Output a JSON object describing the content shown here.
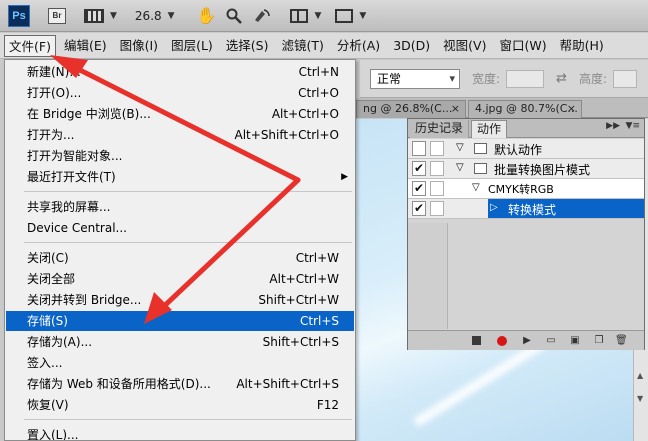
{
  "appbar": {
    "ps_label": "Ps",
    "br_label": "Br",
    "zoom_value": "26.8"
  },
  "menubar": {
    "items": [
      {
        "label": "文件(F)"
      },
      {
        "label": "编辑(E)"
      },
      {
        "label": "图像(I)"
      },
      {
        "label": "图层(L)"
      },
      {
        "label": "选择(S)"
      },
      {
        "label": "滤镜(T)"
      },
      {
        "label": "分析(A)"
      },
      {
        "label": "3D(D)"
      },
      {
        "label": "视图(V)"
      },
      {
        "label": "窗口(W)"
      },
      {
        "label": "帮助(H)"
      }
    ]
  },
  "options": {
    "mode_value": "正常",
    "width_label": "宽度:",
    "height_label": "高度:"
  },
  "doc_tabs": [
    {
      "label": "ng @ 26.8%(C..."
    },
    {
      "label": "4.jpg @ 80.7%(C..."
    }
  ],
  "file_menu": {
    "items": [
      {
        "label": "新建(N)...",
        "shortcut": "Ctrl+N"
      },
      {
        "label": "打开(O)...",
        "shortcut": "Ctrl+O"
      },
      {
        "label": "在 Bridge 中浏览(B)...",
        "shortcut": "Alt+Ctrl+O"
      },
      {
        "label": "打开为...",
        "shortcut": "Alt+Shift+Ctrl+O"
      },
      {
        "label": "打开为智能对象...",
        "shortcut": ""
      },
      {
        "label": "最近打开文件(T)",
        "shortcut": ""
      },
      {
        "label": "共享我的屏幕...",
        "shortcut": ""
      },
      {
        "label": "Device Central...",
        "shortcut": ""
      },
      {
        "label": "关闭(C)",
        "shortcut": "Ctrl+W"
      },
      {
        "label": "关闭全部",
        "shortcut": "Alt+Ctrl+W"
      },
      {
        "label": "关闭并转到 Bridge...",
        "shortcut": "Shift+Ctrl+W"
      },
      {
        "label": "存储(S)",
        "shortcut": "Ctrl+S"
      },
      {
        "label": "存储为(A)...",
        "shortcut": "Shift+Ctrl+S"
      },
      {
        "label": "签入...",
        "shortcut": ""
      },
      {
        "label": "存储为 Web 和设备所用格式(D)...",
        "shortcut": "Alt+Shift+Ctrl+S"
      },
      {
        "label": "恢复(V)",
        "shortcut": "F12"
      },
      {
        "label": "置入(L)...",
        "shortcut": ""
      }
    ]
  },
  "actions_panel": {
    "tab_history": "历史记录",
    "tab_actions": "动作",
    "rows": [
      {
        "label": "默认动作"
      },
      {
        "label": "批量转换图片模式"
      },
      {
        "label": "CMYK转RGB"
      },
      {
        "label": "转换模式"
      }
    ]
  },
  "colors": {
    "highlight": "#0a64c8",
    "arrow": "#e8312a"
  }
}
